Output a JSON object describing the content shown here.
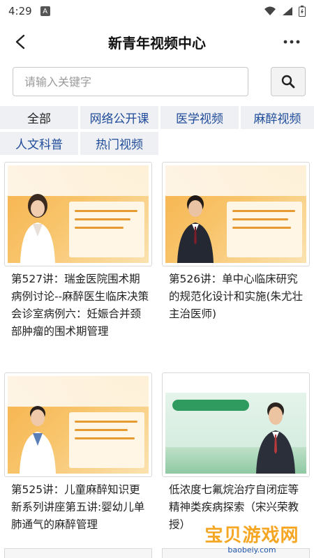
{
  "status_bar": {
    "time": "4:29",
    "notification_icon": "a-box-icon",
    "icons": [
      "wifi-icon",
      "signal-icon",
      "battery-icon"
    ]
  },
  "navbar": {
    "title": "新青年视频中心",
    "back_icon": "chevron-left-icon",
    "more_icon": "more-dots-icon"
  },
  "search": {
    "placeholder": "请输入关键字",
    "value": "",
    "button_icon": "search-icon"
  },
  "categories": [
    {
      "label": "全部",
      "active": true
    },
    {
      "label": "网络公开课",
      "active": false
    },
    {
      "label": "医学视频",
      "active": false
    },
    {
      "label": "麻醉视频",
      "active": false
    },
    {
      "label": "人文科普",
      "active": false
    },
    {
      "label": "热门视频",
      "active": false
    }
  ],
  "videos": [
    {
      "title": "第527讲：瑞金医院围术期病例讨论--麻醉医生临床决策会诊室病例六：妊娠合并颈部肿瘤的围术期管理",
      "thumb_style": "orange-female"
    },
    {
      "title": "第526讲：单中心临床研究的规范化设计和实施(朱尤壮主治医师)",
      "thumb_style": "orange-male"
    },
    {
      "title": "第525讲：儿童麻醉知识更新系列讲座第五讲:婴幼儿单肺通气的麻醉管理",
      "thumb_style": "orange-male-2"
    },
    {
      "title": "低浓度七氟烷治疗自闭症等精神类疾病探索（宋兴荣教授）",
      "thumb_style": "green-male"
    }
  ],
  "watermark": {
    "main": "宝贝游戏网",
    "sub": "baobeiy.com"
  },
  "colors": {
    "category_text": "#1f4b9a",
    "category_bg": "#eef0f3",
    "poster_orange": "#f6b24c",
    "poster_green": "#2f9b5f"
  }
}
